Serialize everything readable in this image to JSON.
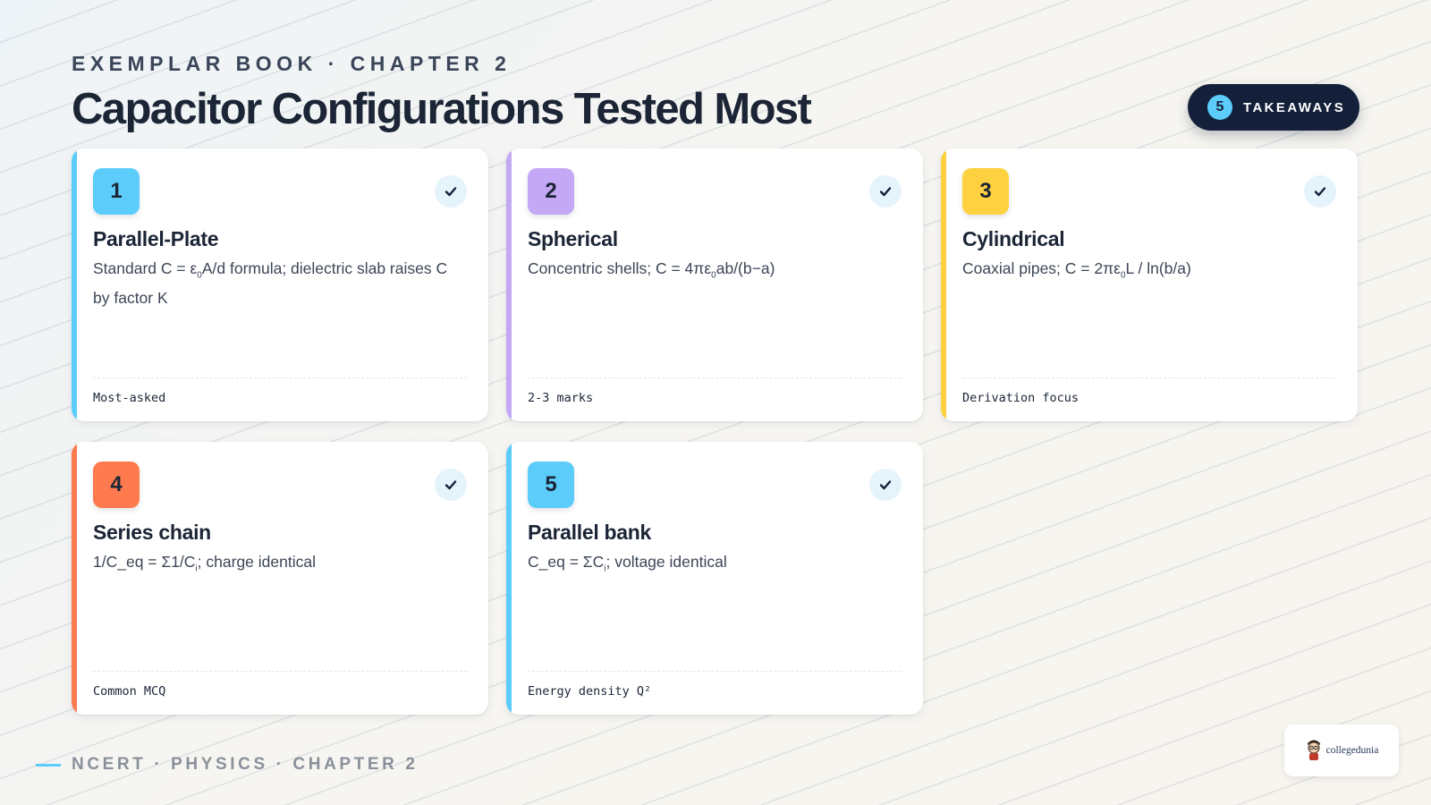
{
  "header": {
    "eyebrow": "EXEMPLAR BOOK · CHAPTER 2",
    "title": "Capacitor Configurations Tested Most",
    "pill_count": "5",
    "pill_label": "TAKEAWAYS"
  },
  "cards": [
    {
      "num": "1",
      "title": "Parallel-Plate",
      "desc_pre": "Standard C = ε",
      "desc_sub": "0",
      "desc_post": "A/d formula; dielectric slab raises C by factor K",
      "tag": "Most-asked",
      "color": "#5ccdfb"
    },
    {
      "num": "2",
      "title": "Spherical",
      "desc_pre": "Concentric shells; C = 4πε",
      "desc_sub": "0",
      "desc_post": "ab/(b−a)",
      "tag": "2-3 marks",
      "color": "#c4a8f6"
    },
    {
      "num": "3",
      "title": "Cylindrical",
      "desc_pre": "Coaxial pipes; C = 2πε",
      "desc_sub": "0",
      "desc_post": "L / ln(b/a)",
      "tag": "Derivation focus",
      "color": "#fdd13f"
    },
    {
      "num": "4",
      "title": "Series chain",
      "desc_pre": "1/C_eq = Σ1/C",
      "desc_sub": "i",
      "desc_post": "; charge identical",
      "tag": "Common MCQ",
      "color": "#ff7a4e"
    },
    {
      "num": "5",
      "title": "Parallel bank",
      "desc_pre": "C_eq = ΣC",
      "desc_sub": "i",
      "desc_post": "; voltage identical",
      "tag": "Energy density Q²",
      "color": "#5ccdfb"
    }
  ],
  "footer": {
    "text": "NCERT · PHYSICS · CHAPTER 2"
  },
  "logo": {
    "text": "collegedunia"
  }
}
